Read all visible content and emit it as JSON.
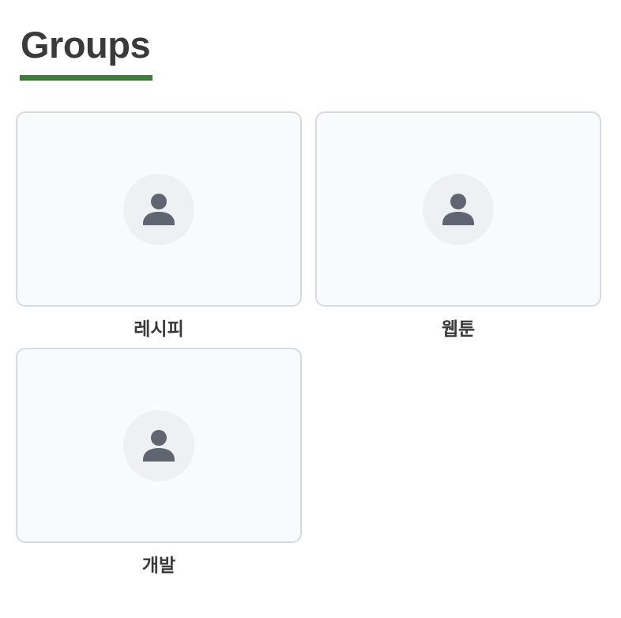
{
  "header": {
    "title": "Groups",
    "accent_color": "#3f7a3a"
  },
  "groups": [
    {
      "name": "레시피",
      "icon": "person-icon"
    },
    {
      "name": "웹툰",
      "icon": "person-icon"
    },
    {
      "name": "개발",
      "icon": "person-icon"
    }
  ]
}
